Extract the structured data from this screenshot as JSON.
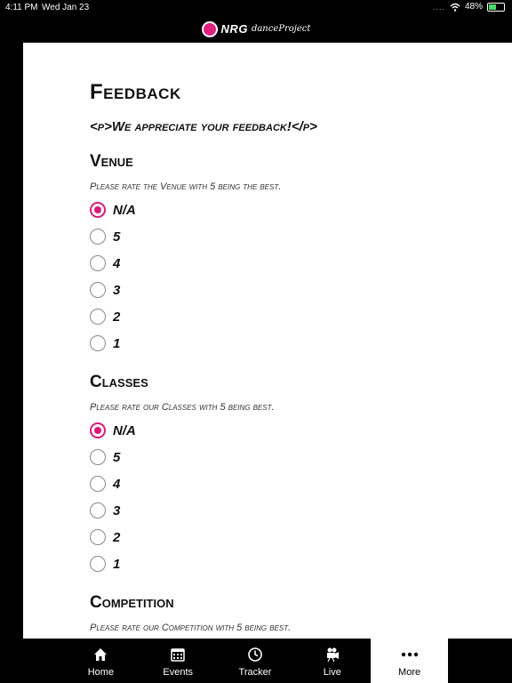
{
  "status": {
    "time": "4:11 PM",
    "date": "Wed Jan 23",
    "battery": "48%",
    "signal_dots": "...."
  },
  "header": {
    "brand": "NRG",
    "sub": "danceProject"
  },
  "page": {
    "title": "Feedback",
    "intro": "<p>We appreciate your feedback!</p>"
  },
  "sections": {
    "venue": {
      "title": "Venue",
      "prompt": "Please rate the Venue with 5 being the best.",
      "options": [
        "N/A",
        "5",
        "4",
        "3",
        "2",
        "1"
      ]
    },
    "classes": {
      "title": "Classes",
      "prompt": "Please rate our Classes with 5 being best.",
      "options": [
        "N/A",
        "5",
        "4",
        "3",
        "2",
        "1"
      ]
    },
    "competition": {
      "title": "Competition",
      "prompt": "Please rate our Competition with 5 being best."
    }
  },
  "tabs": [
    {
      "label": "Home",
      "icon": "house-icon"
    },
    {
      "label": "Events",
      "icon": "calendar-icon"
    },
    {
      "label": "Tracker",
      "icon": "clock-icon"
    },
    {
      "label": "Live",
      "icon": "video-camera-icon"
    },
    {
      "label": "More",
      "icon": "more-dots-icon"
    }
  ],
  "colors": {
    "accent": "#d81b7a",
    "background": "#000000",
    "content": "#ffffff"
  }
}
